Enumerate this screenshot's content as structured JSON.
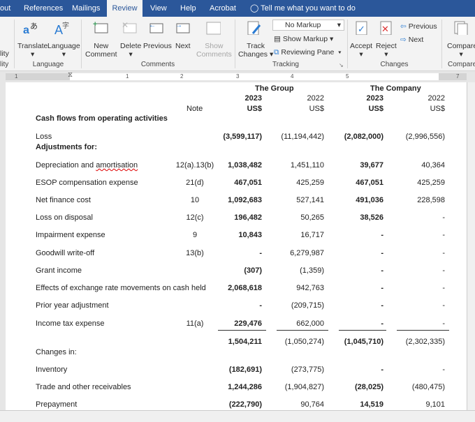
{
  "tabs": [
    {
      "label": "out"
    },
    {
      "label": "References"
    },
    {
      "label": "Mailings"
    },
    {
      "label": "Review",
      "active": true
    },
    {
      "label": "View"
    },
    {
      "label": "Help"
    },
    {
      "label": "Acrobat"
    }
  ],
  "tell_me": "Tell me what you want to do",
  "ribbon": {
    "partial_left": [
      "lity",
      "lity"
    ],
    "translate": "Translate",
    "language": "Language",
    "group_language": "Language",
    "new_comment": [
      "New",
      "Comment"
    ],
    "delete": "Delete",
    "previous": "Previous",
    "next": "Next",
    "show_comments": [
      "Show",
      "Comments"
    ],
    "group_comments": "Comments",
    "track_changes": [
      "Track",
      "Changes"
    ],
    "markup_select": "No Markup",
    "show_markup": "Show Markup",
    "reviewing_pane": "Reviewing Pane",
    "group_tracking": "Tracking",
    "accept": "Accept",
    "reject": "Reject",
    "prev_change": "Previous",
    "next_change": "Next",
    "group_changes": "Changes",
    "compare": "Compare",
    "group_compare": "Compare"
  },
  "ruler_labels": [
    "1",
    "1",
    "2",
    "3",
    "4",
    "5",
    "7"
  ],
  "table": {
    "group_header": "The Group",
    "company_header": "The Company",
    "note_header": "Note",
    "years": [
      "2023",
      "2022",
      "2023",
      "2022"
    ],
    "currency": [
      "US$",
      "US$",
      "US$",
      "US$"
    ],
    "rows": [
      {
        "label": "Cash flows from operating activities",
        "bold": true
      },
      {
        "label": "Loss",
        "note": "",
        "v": [
          "(3,599,117)",
          "(11,194,442)",
          "(2,082,000)",
          "(2,996,556)"
        ]
      },
      {
        "label": "Adjustments for:",
        "bold": true
      },
      {
        "label": "Depreciation and amortisation",
        "note": "12(a).13(b)",
        "v": [
          "1,038,482",
          "1,451,110",
          "39,677",
          "40,364"
        ]
      },
      {
        "label": "ESOP compensation expense",
        "note": "21(d)",
        "v": [
          "467,051",
          "425,259",
          "467,051",
          "425,259"
        ]
      },
      {
        "label": "Net finance cost",
        "note": "10",
        "v": [
          "1,092,683",
          "527,141",
          "491,036",
          "228,598"
        ]
      },
      {
        "label": "Loss on disposal",
        "note": "12(c)",
        "v": [
          "196,482",
          "50,265",
          "38,526",
          "-"
        ]
      },
      {
        "label": "Impairment expense",
        "note": "9",
        "v": [
          "10,843",
          "16,717",
          "-",
          "-"
        ]
      },
      {
        "label": "Goodwill write-off",
        "note": "13(b)",
        "v": [
          "-",
          "6,279,987",
          "-",
          "-"
        ]
      },
      {
        "label": "Grant income",
        "note": "",
        "v": [
          "(307)",
          "(1,359)",
          "-",
          "-"
        ]
      },
      {
        "label": "Effects of exchange rate movements on cash held",
        "note": "",
        "v": [
          "2,068,618",
          "942,763",
          "-",
          "-"
        ]
      },
      {
        "label": "Prior year adjustment",
        "note": "",
        "v": [
          "-",
          "(209,715)",
          "-",
          "-"
        ]
      },
      {
        "label": "Income tax expense",
        "note": "11(a)",
        "v": [
          "229,476",
          "662,000",
          "-",
          "-"
        ],
        "underline": true
      },
      {
        "label": "",
        "note": "",
        "v": [
          "1,504,211",
          "(1,050,274)",
          "(1,045,710)",
          "(2,302,335)"
        ]
      },
      {
        "label": "Changes in:"
      },
      {
        "label": "Inventory",
        "note": "",
        "v": [
          "(182,691)",
          "(273,775)",
          "-",
          "-"
        ]
      },
      {
        "label": "Trade and other receivables",
        "note": "",
        "v": [
          "1,244,286",
          "(1,904,827)",
          "(28,025)",
          "(480,475)"
        ]
      },
      {
        "label": "Prepayment",
        "note": "",
        "v": [
          "(222,790)",
          "90,764",
          "14,519",
          "9,101"
        ]
      }
    ]
  }
}
